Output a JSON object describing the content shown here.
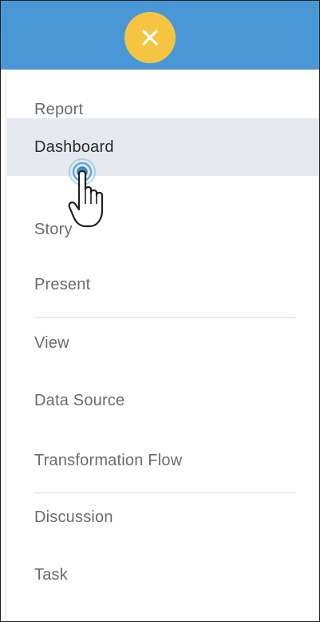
{
  "close_button": {
    "icon": "close-icon",
    "color": "#f5c542"
  },
  "header": {
    "color": "#4a97d6"
  },
  "menu": {
    "items": [
      {
        "label": "Report"
      },
      {
        "label": "Dashboard",
        "active": true
      },
      {
        "label": "Story"
      },
      {
        "label": "Present"
      },
      {
        "label": "View"
      },
      {
        "label": "Data Source"
      },
      {
        "label": "Transformation Flow"
      },
      {
        "label": "Discussion"
      },
      {
        "label": "Task"
      }
    ]
  },
  "cursor": {
    "icon": "hand-pointer-icon"
  }
}
